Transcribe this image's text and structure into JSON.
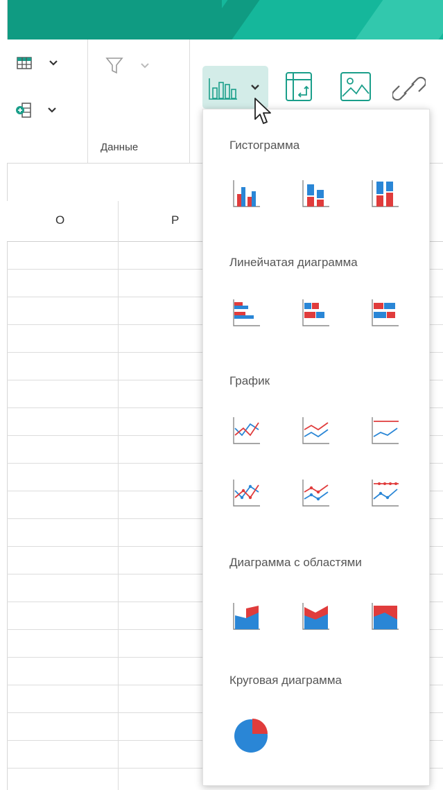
{
  "ribbon": {
    "group_data_label": "Данные"
  },
  "columns": [
    "O",
    "P"
  ],
  "dropdown": {
    "sections": [
      {
        "title": "Гистограмма",
        "items": [
          "column-clustered",
          "column-stacked",
          "column-stacked-100"
        ]
      },
      {
        "title": "Линейчатая диаграмма",
        "items": [
          "bar-clustered",
          "bar-stacked",
          "bar-stacked-100"
        ]
      },
      {
        "title": "График",
        "items": [
          "line",
          "line-stacked",
          "line-stacked-100",
          "line-markers",
          "line-stacked-markers",
          "line-stacked-100-markers"
        ]
      },
      {
        "title": "Диаграмма с областями",
        "items": [
          "area",
          "area-stacked",
          "area-stacked-100"
        ]
      },
      {
        "title": "Круговая диаграмма",
        "items": [
          "pie"
        ]
      }
    ]
  },
  "colors": {
    "title_bar": "#15b79b",
    "title_bar_dark": "#0f9b82",
    "active_button_bg": "#d3ece8",
    "icon_teal": "#1a9e8a",
    "series_blue": "#2a86d6",
    "series_red": "#e03c3c"
  }
}
